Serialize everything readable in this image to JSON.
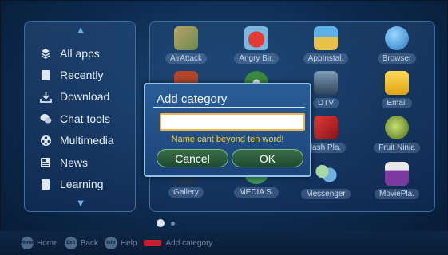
{
  "sidebar": {
    "items": [
      {
        "label": "All apps",
        "icon": "all-apps-icon"
      },
      {
        "label": "Recently",
        "icon": "recent-icon"
      },
      {
        "label": "Download",
        "icon": "download-icon"
      },
      {
        "label": "Chat tools",
        "icon": "chat-icon"
      },
      {
        "label": "Multimedia",
        "icon": "multimedia-icon"
      },
      {
        "label": "News",
        "icon": "news-icon"
      },
      {
        "label": "Learning",
        "icon": "learning-icon"
      }
    ]
  },
  "apps": [
    {
      "label": "AirAttack",
      "icon": "airattack-icon",
      "color": "#8a9b6a"
    },
    {
      "label": "Angry Bir.",
      "icon": "angry-birds-icon",
      "color": "#c8302e"
    },
    {
      "label": "AppInstal.",
      "icon": "app-installer-icon",
      "color": "#e7c14a"
    },
    {
      "label": "Browser",
      "icon": "browser-icon",
      "color": "#3aa0e0"
    },
    {
      "label": "",
      "icon": "partial-app-icon",
      "color": "#b2452b"
    },
    {
      "label": "",
      "icon": "partial-app-icon-2",
      "color": "#3a8b3e"
    },
    {
      "label": "DTV",
      "icon": "dtv-icon",
      "color": "#4a5a6e"
    },
    {
      "label": "Email",
      "icon": "email-icon",
      "color": "#f0c020"
    },
    {
      "label": "",
      "icon": "hidden-app-icon",
      "color": "#3a6e9a"
    },
    {
      "label": "",
      "icon": "hidden-app-icon-2",
      "color": "#3a6e9a"
    },
    {
      "label": "lash Pla.",
      "icon": "flash-player-icon",
      "color": "#c8252b"
    },
    {
      "label": "Fruit Ninja",
      "icon": "fruit-ninja-icon",
      "color": "#6a8a2e"
    },
    {
      "label": "Gallery",
      "icon": "gallery-icon",
      "color": "#2a4a6a"
    },
    {
      "label": "MEDIA S.",
      "icon": "media-server-icon",
      "color": "#3f8f5a"
    },
    {
      "label": "Messenger",
      "icon": "messenger-icon",
      "color": "#5aa0d0"
    },
    {
      "label": "MoviePla.",
      "icon": "movie-player-icon",
      "color": "#7a3aa0"
    }
  ],
  "bottombar": {
    "home_key": "Home",
    "home_label": "Home",
    "back_key": "Exit",
    "back_label": "Back",
    "help_key": "Info",
    "help_label": "Help",
    "add_label": "Add category"
  },
  "dialog": {
    "title": "Add category",
    "input_value": "",
    "error": "Name cant beyond ten word!",
    "cancel": "Cancel",
    "ok": "OK"
  }
}
